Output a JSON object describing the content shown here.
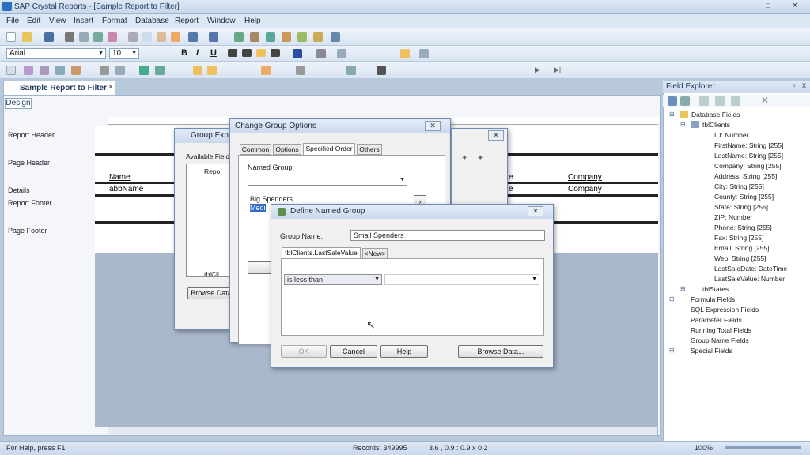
{
  "window": {
    "title": "SAP Crystal Reports - [Sample Report to Filter]",
    "minimize": "–",
    "maximize": "□",
    "close": "✕"
  },
  "menubar": [
    "File",
    "Edit",
    "View",
    "Insert",
    "Format",
    "Database",
    "Report",
    "Window",
    "Help"
  ],
  "format_toolbar": {
    "font": "Arial",
    "size": "10",
    "bold": "B",
    "italic": "I",
    "underline": "U"
  },
  "document_tab": {
    "label": "Sample Report to Filter",
    "close": "×"
  },
  "design_tab": "Design",
  "report_sections": [
    "Report Header",
    "Page Header",
    "Details",
    "Report Footer",
    "Page Footer"
  ],
  "report_fields": {
    "page_header_name": "Name",
    "details_name": "abbName",
    "page_header_company": "Company",
    "details_company": "Company",
    "right_e1": "e",
    "right_e2": "e"
  },
  "field_explorer": {
    "title": "Field Explorer",
    "pin": "ᵖ",
    "close": "x",
    "items": [
      "Database Fields",
      "tblClients",
      "ID: Number",
      "FirstName: String [255]",
      "LastName: String [255]",
      "Company: String [255]",
      "Address: String [255]",
      "City: String [255]",
      "County: String [255]",
      "State: String [255]",
      "ZIP: Number",
      "Phone: String [255]",
      "Fax: String [255]",
      "Email: String [255]",
      "Web: String [255]",
      "LastSaleDate: DateTime",
      "LastSaleValue: Number",
      "tblStates",
      "Formula Fields",
      "SQL Expression Fields",
      "Parameter Fields",
      "Running Total Fields",
      "Group Name Fields",
      "Special Fields"
    ]
  },
  "group_expert": {
    "title": "Group Expe",
    "available_fields": "Available Field",
    "tree_items": [
      "Repo",
      "tblCli"
    ],
    "browse_data": "Browse Data"
  },
  "change_group_options": {
    "title": "Change Group Options",
    "tabs": [
      "Common",
      "Options",
      "Specified Order",
      "Others"
    ],
    "named_group_label": "Named Group:",
    "list_items": [
      "Big Spenders",
      "Medi"
    ]
  },
  "define_named_group": {
    "title": "Define Named Group",
    "group_name_label": "Group Name:",
    "group_name_value": "Small Spenders",
    "tabs": [
      "tblClients.LastSaleValue",
      "<New>"
    ],
    "operator": "is less than",
    "buttons": {
      "ok": "OK",
      "cancel": "Cancel",
      "help": "Help",
      "browse": "Browse Data..."
    }
  },
  "statusbar": {
    "help": "For Help, press F1",
    "records": "Records: 349995",
    "position": "3.6 , 0.9 : 0.9 x 0.2",
    "zoom": "100%"
  }
}
